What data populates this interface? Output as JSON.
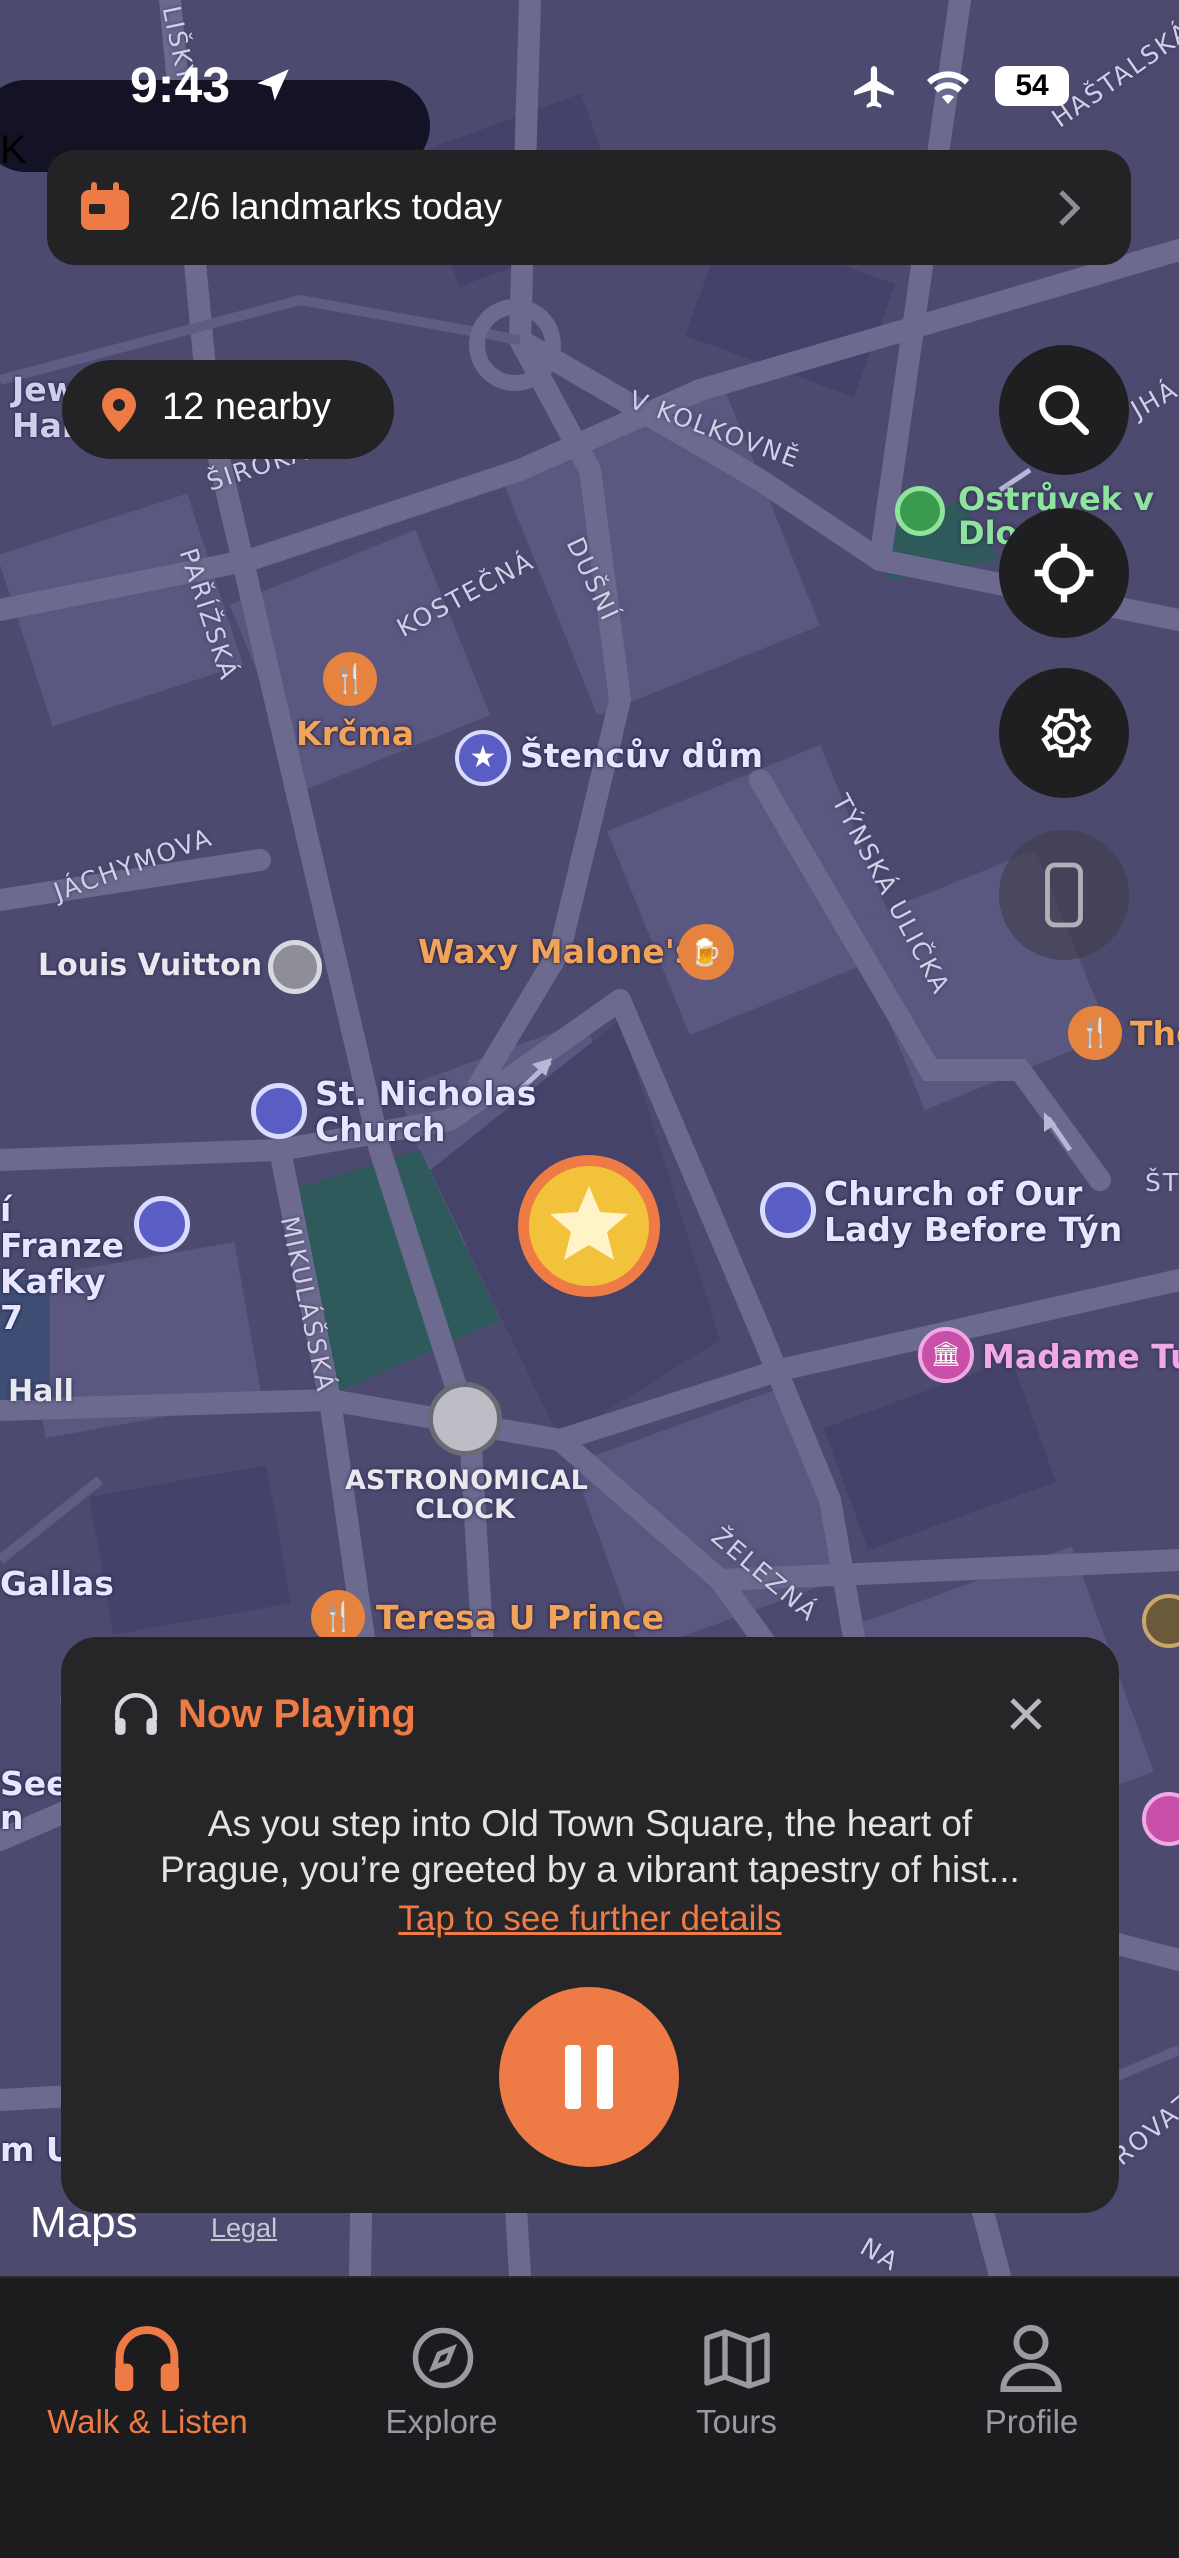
{
  "status": {
    "time": "9:43",
    "battery": "54"
  },
  "banner": {
    "text": "2/6 landmarks today"
  },
  "nearby": {
    "text": "12 nearby"
  },
  "map": {
    "pois": {
      "jewish_town_hall": "Jewish Town Hall, Prague",
      "ostruvek": "Ostrůvek v Dlouhé",
      "krcma": "Krčma",
      "stencuv_dum": "Štencův dům",
      "louis_vuitton": "Louis Vuitton",
      "waxy_malones": "Waxy Malone's",
      "the": "The",
      "st_nicholas": "St. Nicholas Church",
      "franz_kafka": "í Franze Kafky 7",
      "church_tyn": "Church of Our Lady Before Týn",
      "madame_tussauds": "Madame Tus",
      "hall": "Hall",
      "astronomical_clock": "ASTRONOMICAL CLOCK",
      "gallas": "Gallas",
      "teresa": "Teresa U Prince",
      "seer": "Seer",
      "n": "n",
      "mu": "m U",
      "k": "K"
    },
    "streets": {
      "v_kolkovne": "V KOLKOVNĚ",
      "siroka": "ŠIROKÁ",
      "parizska": "PAŘÍŽSKÁ",
      "kostecna": "KOSTEČNÁ",
      "dusni": "DUŠNÍ",
      "jachymova": "JÁCHYMOVA",
      "tynska": "TÝNSKÁ ULIČKA",
      "mikulasska": "MIKULÁŠSKÁ",
      "zelezna": "ŽELEZNÁ",
      "hastalska": "HAŠTALSKÁ",
      "lisky": "LIŠKY",
      "provaz": "PROVAZ",
      "na": "NA",
      "st": "ŠT",
      "dlouha": "JHÁ"
    },
    "attribution": {
      "brand": "Maps",
      "legal": "Legal"
    }
  },
  "now_playing": {
    "title": "Now Playing",
    "body_line1": "As you step into Old Town Square, the heart of",
    "body_line2": "Prague, you’re greeted by a vibrant tapestry of hist...",
    "link": "Tap to see further details"
  },
  "tabs": [
    {
      "label": "Walk & Listen",
      "icon": "headphones-icon",
      "active": true
    },
    {
      "label": "Explore",
      "icon": "compass-icon",
      "active": false
    },
    {
      "label": "Tours",
      "icon": "map-icon",
      "active": false
    },
    {
      "label": "Profile",
      "icon": "person-icon",
      "active": false
    }
  ],
  "colors": {
    "accent": "#ee7b45",
    "map_bg": "#4d4a70",
    "card_bg": "#262628",
    "inactive_tab": "#9a9aa0"
  }
}
